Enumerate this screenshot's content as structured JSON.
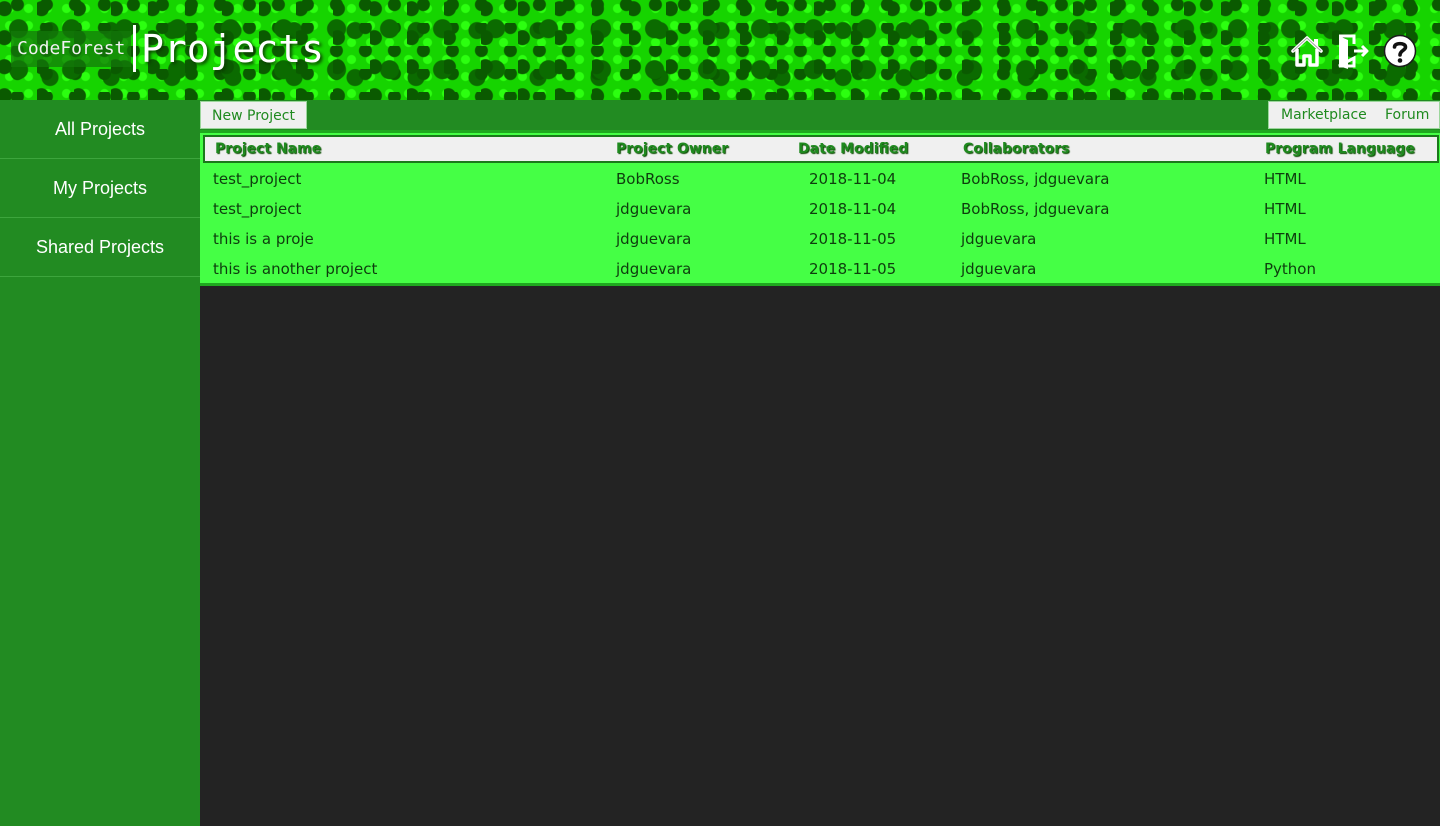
{
  "header": {
    "brand": "CodeForest",
    "title": "Projects",
    "icons": [
      "home-icon",
      "logout-icon",
      "help-icon"
    ]
  },
  "sidebar": {
    "items": [
      {
        "label": "All Projects"
      },
      {
        "label": "My Projects"
      },
      {
        "label": "Shared Projects"
      }
    ]
  },
  "toolbar": {
    "new_project": "New Project",
    "marketplace": "Marketplace",
    "forum": "Forum"
  },
  "table": {
    "headers": [
      "Project Name",
      "Project Owner",
      "Date Modified",
      "Collaborators",
      "Program Language"
    ],
    "rows": [
      {
        "name": "test_project",
        "owner": "BobRoss",
        "date": "2018-11-04",
        "collaborators": "BobRoss, jdguevara",
        "language": "HTML"
      },
      {
        "name": "test_project",
        "owner": "jdguevara",
        "date": "2018-11-04",
        "collaborators": "BobRoss, jdguevara",
        "language": "HTML"
      },
      {
        "name": "this is a proje",
        "owner": "jdguevara",
        "date": "2018-11-05",
        "collaborators": "jdguevara",
        "language": "HTML"
      },
      {
        "name": "this is another project",
        "owner": "jdguevara",
        "date": "2018-11-05",
        "collaborators": "jdguevara",
        "language": "Python"
      }
    ]
  },
  "colors": {
    "header_green": "#16d400",
    "sidebar_green": "#228b22",
    "table_green": "#45ff45",
    "content_bg": "#232323"
  }
}
